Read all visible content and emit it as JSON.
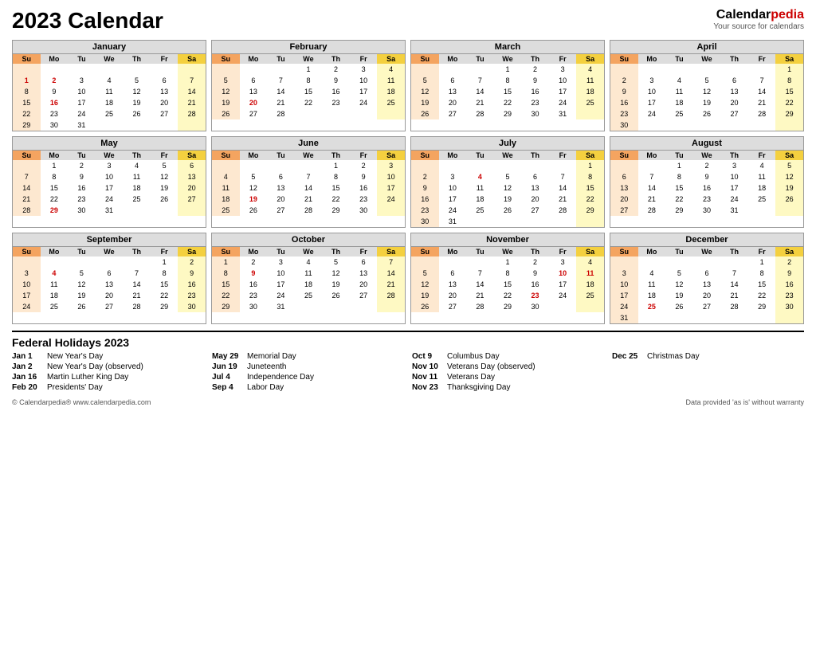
{
  "header": {
    "title": "2023 Calendar",
    "brand_name": "Calendar",
    "brand_red": "pedia",
    "brand_sub": "Your source for calendars"
  },
  "months": [
    {
      "name": "January",
      "weeks": [
        [
          "",
          "",
          "",
          "",
          "",
          "",
          ""
        ],
        [
          "1",
          "2",
          "3",
          "4",
          "5",
          "6",
          "7"
        ],
        [
          "8",
          "9",
          "10",
          "11",
          "12",
          "13",
          "14"
        ],
        [
          "15",
          "16",
          "17",
          "18",
          "19",
          "20",
          "21"
        ],
        [
          "22",
          "23",
          "24",
          "25",
          "26",
          "27",
          "28"
        ],
        [
          "29",
          "30",
          "31",
          "",
          "",
          "",
          ""
        ]
      ],
      "start_day": 0,
      "holidays": {
        "1": "red",
        "2": "red",
        "16": "red"
      }
    },
    {
      "name": "February",
      "weeks": [
        [
          "",
          "",
          "",
          "1",
          "2",
          "3",
          "4"
        ],
        [
          "5",
          "6",
          "7",
          "8",
          "9",
          "10",
          "11"
        ],
        [
          "12",
          "13",
          "14",
          "15",
          "16",
          "17",
          "18"
        ],
        [
          "19",
          "20",
          "21",
          "22",
          "23",
          "24",
          "25"
        ],
        [
          "26",
          "27",
          "28",
          "",
          "",
          "",
          ""
        ]
      ],
      "holidays": {
        "20": "red"
      }
    },
    {
      "name": "March",
      "weeks": [
        [
          "",
          "",
          "",
          "1",
          "2",
          "3",
          "4"
        ],
        [
          "5",
          "6",
          "7",
          "8",
          "9",
          "10",
          "11"
        ],
        [
          "12",
          "13",
          "14",
          "15",
          "16",
          "17",
          "18"
        ],
        [
          "19",
          "20",
          "21",
          "22",
          "23",
          "24",
          "25"
        ],
        [
          "26",
          "27",
          "28",
          "29",
          "30",
          "31",
          ""
        ]
      ],
      "holidays": {}
    },
    {
      "name": "April",
      "weeks": [
        [
          "",
          "",
          "",
          "",
          "",
          "",
          "1"
        ],
        [
          "2",
          "3",
          "4",
          "5",
          "6",
          "7",
          "8"
        ],
        [
          "9",
          "10",
          "11",
          "12",
          "13",
          "14",
          "15"
        ],
        [
          "16",
          "17",
          "18",
          "19",
          "20",
          "21",
          "22"
        ],
        [
          "23",
          "24",
          "25",
          "26",
          "27",
          "28",
          "29"
        ],
        [
          "30",
          "",
          "",
          "",
          "",
          "",
          ""
        ]
      ],
      "holidays": {}
    },
    {
      "name": "May",
      "weeks": [
        [
          "",
          "1",
          "2",
          "3",
          "4",
          "5",
          "6"
        ],
        [
          "7",
          "8",
          "9",
          "10",
          "11",
          "12",
          "13"
        ],
        [
          "14",
          "15",
          "16",
          "17",
          "18",
          "19",
          "20"
        ],
        [
          "21",
          "22",
          "23",
          "24",
          "25",
          "26",
          "27"
        ],
        [
          "28",
          "29",
          "30",
          "31",
          "",
          "",
          ""
        ]
      ],
      "holidays": {
        "29": "red"
      }
    },
    {
      "name": "June",
      "weeks": [
        [
          "",
          "",
          "",
          "",
          "1",
          "2",
          "3"
        ],
        [
          "4",
          "5",
          "6",
          "7",
          "8",
          "9",
          "10"
        ],
        [
          "11",
          "12",
          "13",
          "14",
          "15",
          "16",
          "17"
        ],
        [
          "18",
          "19",
          "20",
          "21",
          "22",
          "23",
          "24"
        ],
        [
          "25",
          "26",
          "27",
          "28",
          "29",
          "30",
          ""
        ]
      ],
      "holidays": {
        "19": "red"
      }
    },
    {
      "name": "July",
      "weeks": [
        [
          "",
          "",
          "",
          "",
          "",
          "",
          "1"
        ],
        [
          "2",
          "3",
          "4",
          "5",
          "6",
          "7",
          "8"
        ],
        [
          "9",
          "10",
          "11",
          "12",
          "13",
          "14",
          "15"
        ],
        [
          "16",
          "17",
          "18",
          "19",
          "20",
          "21",
          "22"
        ],
        [
          "23",
          "24",
          "25",
          "26",
          "27",
          "28",
          "29"
        ],
        [
          "30",
          "31",
          "",
          "",
          "",
          "",
          ""
        ]
      ],
      "holidays": {
        "4": "red"
      }
    },
    {
      "name": "August",
      "weeks": [
        [
          "",
          "",
          "1",
          "2",
          "3",
          "4",
          "5"
        ],
        [
          "6",
          "7",
          "8",
          "9",
          "10",
          "11",
          "12"
        ],
        [
          "13",
          "14",
          "15",
          "16",
          "17",
          "18",
          "19"
        ],
        [
          "20",
          "21",
          "22",
          "23",
          "24",
          "25",
          "26"
        ],
        [
          "27",
          "28",
          "29",
          "30",
          "31",
          "",
          ""
        ]
      ],
      "holidays": {}
    },
    {
      "name": "September",
      "weeks": [
        [
          "",
          "",
          "",
          "",
          "",
          "1",
          "2"
        ],
        [
          "3",
          "4",
          "5",
          "6",
          "7",
          "8",
          "9"
        ],
        [
          "10",
          "11",
          "12",
          "13",
          "14",
          "15",
          "16"
        ],
        [
          "17",
          "18",
          "19",
          "20",
          "21",
          "22",
          "23"
        ],
        [
          "24",
          "25",
          "26",
          "27",
          "28",
          "29",
          "30"
        ]
      ],
      "holidays": {
        "4": "red"
      }
    },
    {
      "name": "October",
      "weeks": [
        [
          "1",
          "2",
          "3",
          "4",
          "5",
          "6",
          "7"
        ],
        [
          "8",
          "9",
          "10",
          "11",
          "12",
          "13",
          "14"
        ],
        [
          "15",
          "16",
          "17",
          "18",
          "19",
          "20",
          "21"
        ],
        [
          "22",
          "23",
          "24",
          "25",
          "26",
          "27",
          "28"
        ],
        [
          "29",
          "30",
          "31",
          "",
          "",
          "",
          ""
        ]
      ],
      "holidays": {
        "9": "red"
      }
    },
    {
      "name": "November",
      "weeks": [
        [
          "",
          "",
          "",
          "1",
          "2",
          "3",
          "4"
        ],
        [
          "5",
          "6",
          "7",
          "8",
          "9",
          "10",
          "11"
        ],
        [
          "12",
          "13",
          "14",
          "15",
          "16",
          "17",
          "18"
        ],
        [
          "19",
          "20",
          "21",
          "22",
          "23",
          "24",
          "25"
        ],
        [
          "26",
          "27",
          "28",
          "29",
          "30",
          "",
          ""
        ]
      ],
      "holidays": {
        "10": "red",
        "11": "red",
        "23": "red"
      }
    },
    {
      "name": "December",
      "weeks": [
        [
          "",
          "",
          "",
          "",
          "",
          "1",
          "2"
        ],
        [
          "3",
          "4",
          "5",
          "6",
          "7",
          "8",
          "9"
        ],
        [
          "10",
          "11",
          "12",
          "13",
          "14",
          "15",
          "16"
        ],
        [
          "17",
          "18",
          "19",
          "20",
          "21",
          "22",
          "23"
        ],
        [
          "24",
          "25",
          "26",
          "27",
          "28",
          "29",
          "30"
        ],
        [
          "31",
          "",
          "",
          "",
          "",
          "",
          ""
        ]
      ],
      "holidays": {
        "25": "red"
      }
    }
  ],
  "day_headers": [
    "Su",
    "Mo",
    "Tu",
    "We",
    "Th",
    "Fr",
    "Sa"
  ],
  "holidays_title": "Federal Holidays 2023",
  "holidays_columns": [
    [
      {
        "date": "Jan 1",
        "name": "New Year's Day"
      },
      {
        "date": "Jan 2",
        "name": "New Year's Day (observed)"
      },
      {
        "date": "Jan 16",
        "name": "Martin Luther King Day"
      },
      {
        "date": "Feb 20",
        "name": "Presidents' Day"
      }
    ],
    [
      {
        "date": "May 29",
        "name": "Memorial Day"
      },
      {
        "date": "Jun 19",
        "name": "Juneteenth"
      },
      {
        "date": "Jul 4",
        "name": "Independence Day"
      },
      {
        "date": "Sep 4",
        "name": "Labor Day"
      }
    ],
    [
      {
        "date": "Oct 9",
        "name": "Columbus Day"
      },
      {
        "date": "Nov 10",
        "name": "Veterans Day (observed)"
      },
      {
        "date": "Nov 11",
        "name": "Veterans Day"
      },
      {
        "date": "Nov 23",
        "name": "Thanksgiving Day"
      }
    ],
    [
      {
        "date": "Dec 25",
        "name": "Christmas Day"
      }
    ]
  ],
  "footer_left": "© Calendarpedia®  www.calendarpedia.com",
  "footer_right": "Data provided 'as is' without warranty"
}
